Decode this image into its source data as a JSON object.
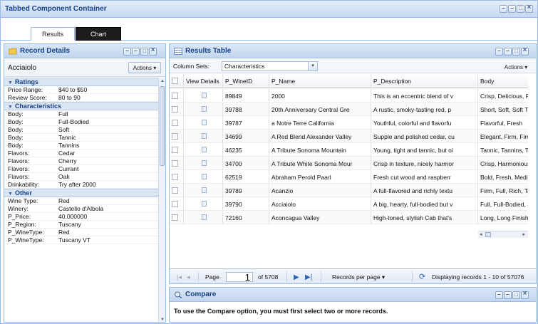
{
  "window": {
    "title": "Tabbed Component Container"
  },
  "tabs": [
    {
      "label": "Results"
    },
    {
      "label": "Chart"
    }
  ],
  "record_details": {
    "title": "Record Details",
    "record_name": "Acciaiolo",
    "actions_label": "Actions ▾",
    "groups": [
      {
        "label": "Ratings",
        "rows": [
          {
            "k": "Price Range:",
            "v": "$40 to $50"
          },
          {
            "k": "Review Score:",
            "v": "80 to 90"
          }
        ]
      },
      {
        "label": "Characteristics",
        "rows": [
          {
            "k": "Body:",
            "v": "Full"
          },
          {
            "k": "Body:",
            "v": "Full-Bodied"
          },
          {
            "k": "Body:",
            "v": "Soft"
          },
          {
            "k": "Body:",
            "v": "Tannic"
          },
          {
            "k": "Body:",
            "v": "Tannins"
          },
          {
            "k": "Flavors:",
            "v": "Cedar"
          },
          {
            "k": "Flavors:",
            "v": "Cherry"
          },
          {
            "k": "Flavors:",
            "v": "Currant"
          },
          {
            "k": "Flavors:",
            "v": "Oak"
          },
          {
            "k": "Drinkability:",
            "v": "Try after 2000"
          }
        ]
      },
      {
        "label": "Other",
        "rows": [
          {
            "k": "Wine Type:",
            "v": "Red"
          },
          {
            "k": "Winery:",
            "v": "Castello d'Albola"
          },
          {
            "k": "P_Price:",
            "v": "40.000000"
          },
          {
            "k": "P_Region:",
            "v": "Tuscany"
          },
          {
            "k": "P_WineType:",
            "v": "Red"
          },
          {
            "k": "P_WineType:",
            "v": "Tuscany VT"
          }
        ]
      }
    ]
  },
  "results": {
    "title": "Results Table",
    "column_sets_label": "Column Sets:",
    "column_sets_value": "Characteristics",
    "actions_label": "Actions ▾",
    "columns": [
      "View Details",
      "P_WineID",
      "P_Name",
      "P_Description",
      "Body"
    ],
    "rows": [
      [
        "89849",
        "2000",
        "This is an eccentric blend of v",
        "Crisp, Delicious, F"
      ],
      [
        "39788",
        "20th Anniversary Central Gre",
        "A rustic, smoky-tasting red, p",
        "Short, Soft, Soft T"
      ],
      [
        "39787",
        "a Notre Terre California",
        "Youthful, colorful and flavorfu",
        "Flavorful, Fresh"
      ],
      [
        "34699",
        "A Red Blend Alexander Valley",
        "Supple and polished cedar, cu",
        "Elegant, Firm, Firm"
      ],
      [
        "46235",
        "A Tribute Sonoma Mountain",
        "Young, tight and tannic, but oi",
        "Tannic, Tannins, T"
      ],
      [
        "34700",
        "A Tribute White Sonoma Mour",
        "Crisp in texture, nicely harmor",
        "Crisp, Harmonious"
      ],
      [
        "62519",
        "Abraham Perold Paarl",
        "Fresh cut wood and raspberr",
        "Bold, Fresh, Medi"
      ],
      [
        "39789",
        "Acanzio",
        "A full-flavored and richly textu",
        "Firm, Full, Rich, Ta"
      ],
      [
        "39790",
        "Acciaiolo",
        "A big, hearty, full-bodied but v",
        "Full, Full-Bodied, S"
      ],
      [
        "72160",
        "Aconcagua Valley",
        "High-toned, stylish Cab that's",
        "Long, Long Finish"
      ]
    ],
    "pager": {
      "page_label": "Page",
      "page_value": "1",
      "of_label": "of 5708",
      "records_per_page": "Records per page ▾",
      "displaying": "Displaying records 1 - 10 of 57076"
    }
  },
  "compare": {
    "title": "Compare",
    "message": "To use the Compare option, you must first select two or more records."
  }
}
